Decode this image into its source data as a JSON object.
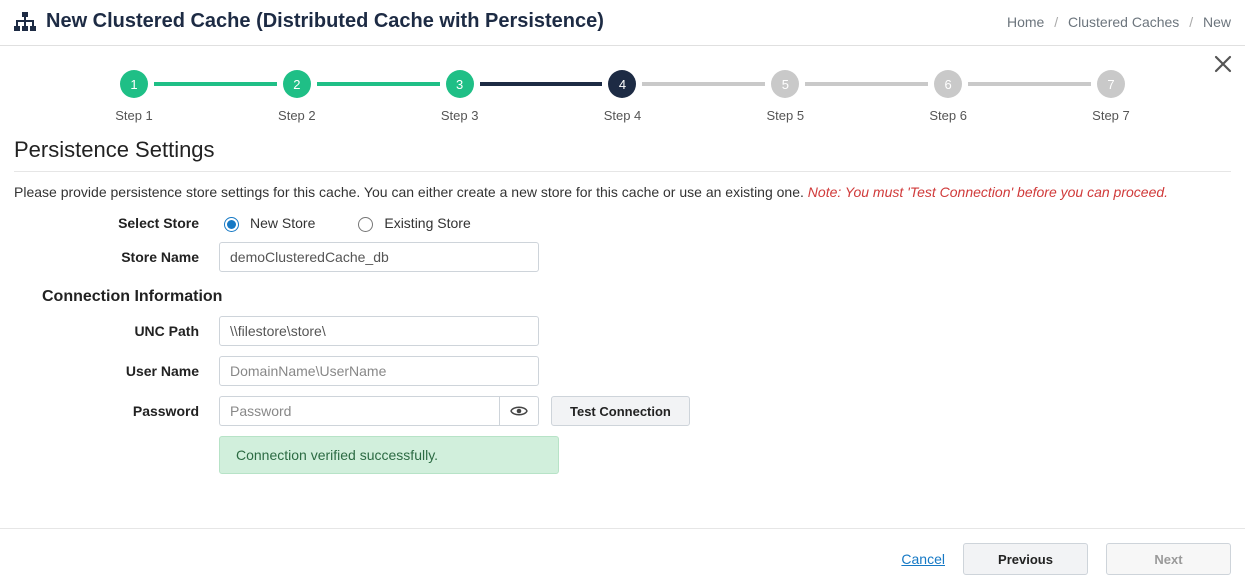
{
  "header": {
    "title": "New Clustered Cache (Distributed Cache with Persistence)",
    "breadcrumbs": [
      "Home",
      "Clustered Caches",
      "New"
    ]
  },
  "stepper": {
    "steps": [
      {
        "num": "1",
        "label": "Step 1",
        "state": "done"
      },
      {
        "num": "2",
        "label": "Step 2",
        "state": "done"
      },
      {
        "num": "3",
        "label": "Step 3",
        "state": "done"
      },
      {
        "num": "4",
        "label": "Step 4",
        "state": "current"
      },
      {
        "num": "5",
        "label": "Step 5",
        "state": "future"
      },
      {
        "num": "6",
        "label": "Step 6",
        "state": "future"
      },
      {
        "num": "7",
        "label": "Step 7",
        "state": "future"
      }
    ]
  },
  "section": {
    "title": "Persistence Settings",
    "intro": "Please provide persistence store settings for this cache. You can either create a new store for this cache or use an existing one.",
    "note": "Note: You must 'Test Connection' before you can proceed."
  },
  "form": {
    "selectStoreLabel": "Select Store",
    "radioNew": "New Store",
    "radioExisting": "Existing Store",
    "storeNameLabel": "Store Name",
    "storeNameValue": "demoClusteredCache_db",
    "connHeading": "Connection Information",
    "uncLabel": "UNC Path",
    "uncValue": "\\\\filestore\\store\\",
    "userLabel": "User Name",
    "userPlaceholder": "DomainName\\UserName",
    "passwordLabel": "Password",
    "passwordPlaceholder": "Password",
    "testConnLabel": "Test Connection",
    "successMsg": "Connection verified successfully."
  },
  "footer": {
    "cancel": "Cancel",
    "previous": "Previous",
    "next": "Next"
  }
}
